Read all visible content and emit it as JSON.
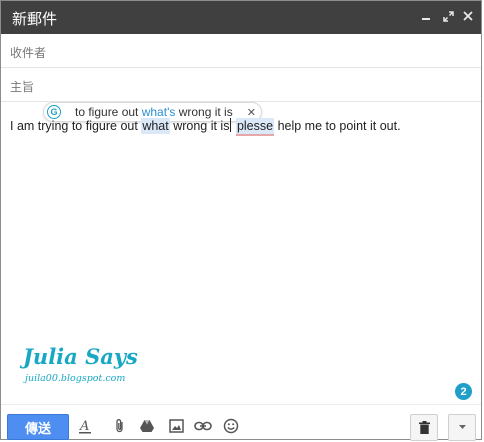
{
  "window": {
    "title": "新郵件",
    "minimize_icon": "minimize-icon",
    "expand_icon": "expand-icon",
    "close_icon": "close-icon"
  },
  "fields": {
    "to_label": "收件者",
    "to_value": "",
    "subject_label": "主旨",
    "subject_value": ""
  },
  "suggestion": {
    "prefix": "to figure out ",
    "highlight": "what's",
    "suffix": " wrong it is",
    "close": "✕"
  },
  "body": {
    "part1": "I am trying to figure out ",
    "word_what": "what",
    "part2": " wrong it is",
    "part3": " ",
    "word_plesse": "plesse",
    "part4": " help me to point it out."
  },
  "watermark": {
    "title": "Julia Says",
    "subtitle": "juila00.blogspot.com"
  },
  "badge": {
    "count": "2",
    "color": "#1f9fc9"
  },
  "toolbar": {
    "send_label": "傳送",
    "send_color": "#4d8ef0",
    "icons": [
      "formatting-icon",
      "attach-icon",
      "drive-icon",
      "photo-icon",
      "link-icon",
      "emoji-icon",
      "trash-icon",
      "more-options-icon"
    ]
  }
}
